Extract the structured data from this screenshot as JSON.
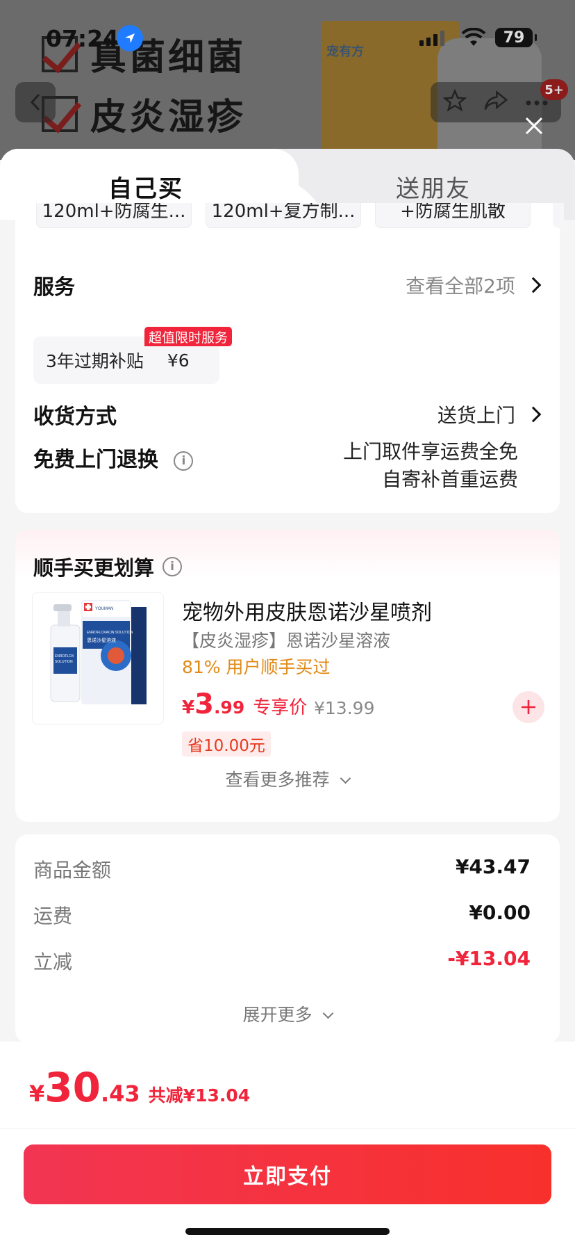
{
  "status_bar": {
    "time": "07:24",
    "battery": "79"
  },
  "background": {
    "banner_line_1": "真菌细菌",
    "banner_line_2": "皮炎湿疹",
    "box_brand": "宠有方",
    "cart_badge": "5+"
  },
  "tabs": {
    "self": "自己买",
    "gift": "送朋友"
  },
  "specs": [
    "120ml+防腐生...",
    "120ml+复方制...",
    "+防腐生肌散"
  ],
  "service": {
    "label": "服务",
    "view_all": "查看全部2项",
    "chip_name": "3年过期补贴",
    "chip_price": "¥6",
    "chip_tag": "超值限时服务"
  },
  "delivery": {
    "label": "收货方式",
    "value": "送货上门"
  },
  "free_return": {
    "label": "免费上门退换",
    "info_icon": "i",
    "line1": "上门取件享运费全免",
    "line2": "自寄补首重运费"
  },
  "recommend": {
    "title": "顺手买更划算",
    "name": "宠物外用皮肤恩诺沙星喷剂",
    "subtitle": "【皮炎湿疹】恩诺沙星溶液",
    "bought_pct": "81% 用户顺手买过",
    "price_cur": "¥",
    "price_int": "3",
    "price_dec": ".99",
    "exclusive": "专享价",
    "orig_price": "¥13.99",
    "save": "省10.00元",
    "more": "查看更多推荐",
    "img_brand": "YOUMAN",
    "img_product": "ENROFLOXACIN SOLUTION",
    "img_cn": "恩诺沙星溶液"
  },
  "amounts": [
    {
      "label": "商品金额",
      "value": "¥43.47",
      "red": false
    },
    {
      "label": "运费",
      "value": "¥0.00",
      "red": false
    },
    {
      "label": "立减",
      "value": "-¥13.04",
      "red": true
    }
  ],
  "amounts_more": "展开更多",
  "footer": {
    "cur": "¥",
    "total_int": "30",
    "total_dec": ".43",
    "save_text": "共减¥13.04",
    "pay_label": "立即支付"
  },
  "colors": {
    "accent_red": "#f0243a",
    "orange": "#e08a17",
    "pay_gradient_start": "#f23552",
    "pay_gradient_end": "#f8302c"
  }
}
